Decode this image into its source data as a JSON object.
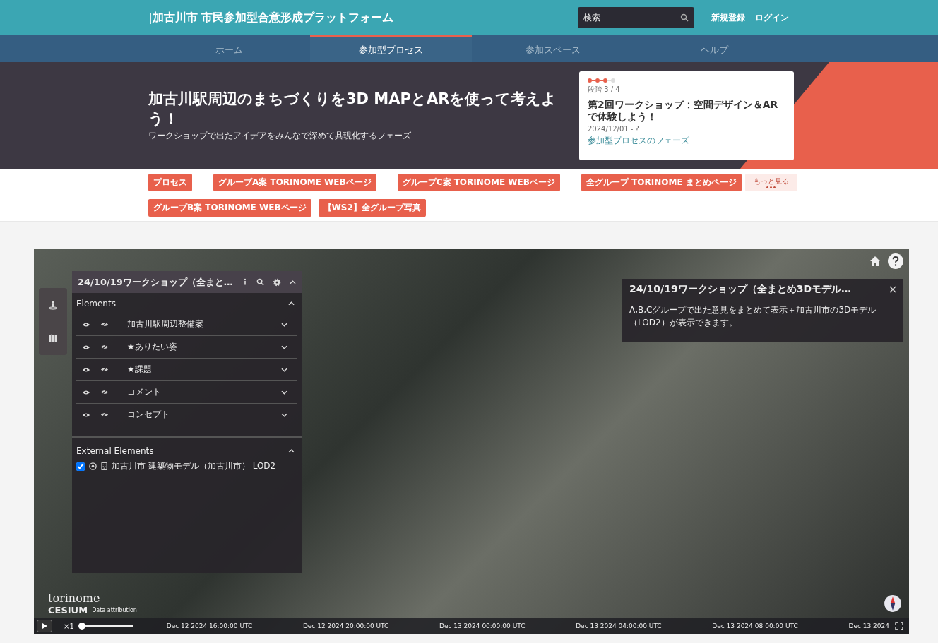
{
  "header": {
    "title": "|加古川市 市民参加型合意形成プラットフォーム",
    "search": {
      "placeholder": "検索"
    },
    "links": [
      "新規登録",
      "ログイン"
    ]
  },
  "nav": [
    {
      "label": "ホーム",
      "selected": false
    },
    {
      "label": "参加型プロセス",
      "selected": true
    },
    {
      "label": "参加スペース",
      "selected": false
    },
    {
      "label": "ヘルプ",
      "selected": false
    }
  ],
  "hero": {
    "title": "加古川駅周辺のまちづくりを3D MAPとARを使って考えよう！",
    "subtitle": "ワークショップで出たアイデアをみんなで深めて具現化するフェーズ",
    "phase_card": {
      "steps": [
        {
          "done": true
        },
        {
          "done": true
        },
        {
          "done": true
        },
        {
          "done": false
        }
      ],
      "stage": "段階 3 / 4",
      "title": "第2回ワークショップ：空間デザイン＆ARで体験しよう！",
      "date": "2024/12/01 - ?",
      "link": "参加型プロセスのフェーズ"
    }
  },
  "link_rows": [
    [
      "プロセス",
      "グループA案 TORINOME WEBページ",
      "グループC案 TORINOME WEBページ",
      "全グループ TORINOME まとめページ"
    ],
    [
      "グループB案 TORINOME WEBページ",
      "【WS2】全グループ写真"
    ]
  ],
  "more_button": "もっと見る",
  "map": {
    "layer_panel": {
      "title": "24/10/19ワークショップ（全まと…",
      "sections": [
        {
          "title": "Elements",
          "expanded": true,
          "items": [
            {
              "label": "加古川駅周辺整備案"
            },
            {
              "label": "★ありたい姿"
            },
            {
              "label": "★課題"
            },
            {
              "label": "コメント"
            },
            {
              "label": "コンセプト"
            }
          ]
        }
      ],
      "external": {
        "title": "External Elements",
        "expanded": true,
        "items": [
          {
            "label": "加古川市 建築物モデル（加古川市） LOD2",
            "checked": true
          }
        ]
      }
    },
    "info_box": {
      "title": "24/10/19ワークショップ（全まとめ3Dモデル…",
      "body": "A,B,Cグループで出た意見をまとめて表示＋加古川市の3Dモデル（LOD2）が表示できます。"
    },
    "logos": {
      "torinome": "torinome",
      "cesium": "CESIUM",
      "attribution": "Data attribution"
    },
    "timeline": {
      "speed": "×1",
      "level": 0,
      "ticks": [
        "Dec 12 2024 16:00:00 UTC",
        "Dec 12 2024 20:00:00 UTC",
        "Dec 13 2024 00:00:00 UTC",
        "Dec 13 2024 04:00:00 UTC",
        "Dec 13 2024 08:00:00 UTC",
        "Dec 13 2024"
      ]
    }
  }
}
